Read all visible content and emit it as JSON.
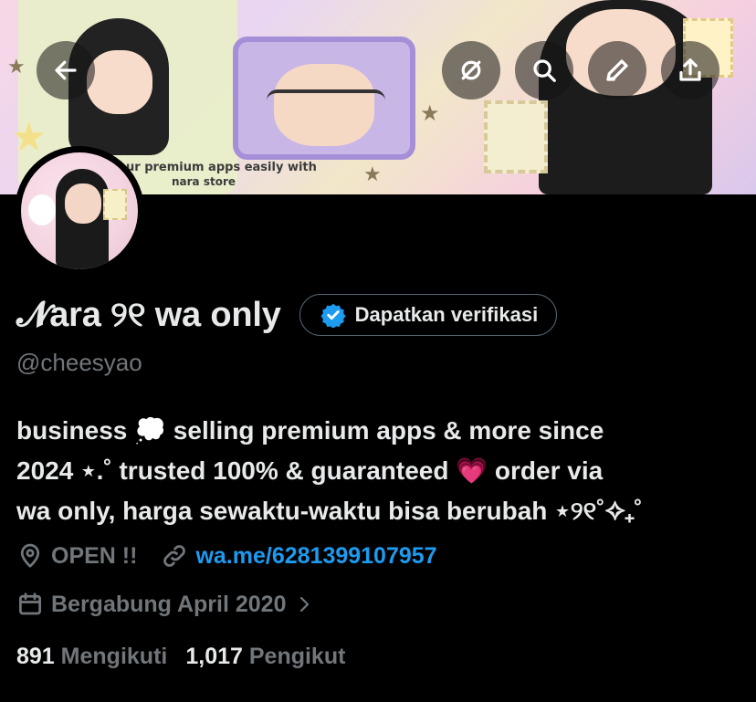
{
  "banner": {
    "text_line1": "ur premium apps easily with",
    "text_line2": "nara store",
    "colors": {
      "pink": "#f7d7e6",
      "lilac": "#e9d6f2",
      "cream": "#f2e7c9"
    }
  },
  "top_actions": [
    {
      "icon": "back-arrow-icon"
    },
    {
      "icon": "grok-icon"
    },
    {
      "icon": "search-icon"
    },
    {
      "icon": "edit-pencil-icon"
    },
    {
      "icon": "share-icon"
    }
  ],
  "profile": {
    "display_name": "𝓝ara ୨୧ wa only",
    "verify_label": "Dapatkan verifikasi",
    "handle": "@cheesyao",
    "bio_line1": "business 💭 selling premium apps & more since",
    "bio_line2": "2024 ⋆.˚ trusted 100% & guaranteed 💗  order via",
    "bio_line3": "wa only, harga sewaktu-waktu bisa berubah ⋆୨୧˚✧₊˚",
    "location": "OPEN !!",
    "link": "wa.me/6281399107957",
    "joined": "Bergabung April 2020"
  },
  "stats": {
    "following_count": "891",
    "following_label": "Mengikuti",
    "followers_count": "1,017",
    "followers_label": "Pengikut"
  },
  "colors": {
    "accent": "#1d9bf0",
    "muted": "#71767b",
    "text": "#e7e9ea",
    "background": "#000000"
  }
}
